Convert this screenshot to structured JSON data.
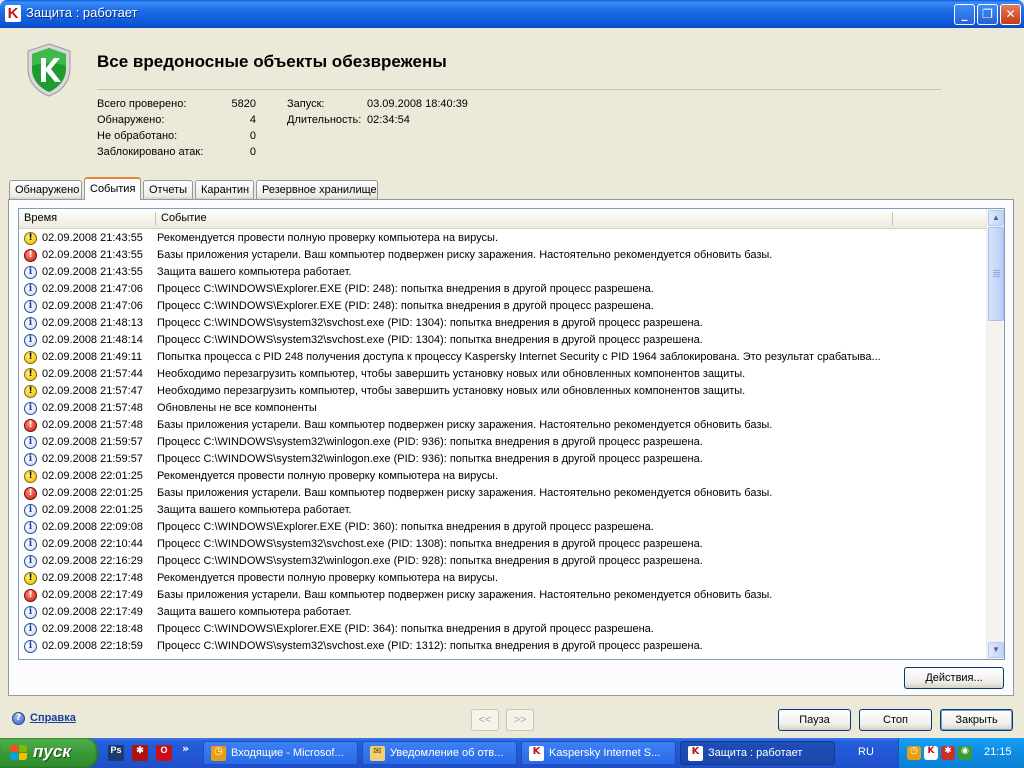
{
  "window": {
    "title": "Защита : работает",
    "app_icon": "kaspersky-k-icon"
  },
  "header": {
    "status_title": "Все вредоносные объекты обезврежены",
    "stats": [
      {
        "label": "Всего проверено:",
        "value": "5820"
      },
      {
        "label": "Обнаружено:",
        "value": "4"
      },
      {
        "label": "Не обработано:",
        "value": "0"
      },
      {
        "label": "Заблокировано атак:",
        "value": "0"
      }
    ],
    "run": {
      "label": "Запуск:",
      "value": "03.09.2008 18:40:39"
    },
    "duration": {
      "label": "Длительность:",
      "value": "02:34:54"
    }
  },
  "tabs": [
    {
      "label": "Обнаружено",
      "active": false
    },
    {
      "label": "События",
      "active": true
    },
    {
      "label": "Отчеты",
      "active": false
    },
    {
      "label": "Карантин",
      "active": false
    },
    {
      "label": "Резервное хранилище",
      "active": false
    }
  ],
  "events": {
    "columns": {
      "time": "Время",
      "event": "Событие"
    },
    "rows": [
      {
        "icon": "warning-icon",
        "time": "02.09.2008 21:43:55",
        "event": "Рекомендуется провести полную проверку компьютера на вирусы."
      },
      {
        "icon": "error-icon",
        "time": "02.09.2008 21:43:55",
        "event": "Базы приложения устарели. Ваш компьютер подвержен риску заражения. Настоятельно рекомендуется обновить базы."
      },
      {
        "icon": "info-icon",
        "time": "02.09.2008 21:43:55",
        "event": "Защита вашего компьютера работает."
      },
      {
        "icon": "info-icon",
        "time": "02.09.2008 21:47:06",
        "event": "Процесс C:\\WINDOWS\\Explorer.EXE (PID: 248): попытка внедрения в другой процесс разрешена."
      },
      {
        "icon": "info-icon",
        "time": "02.09.2008 21:47:06",
        "event": "Процесс C:\\WINDOWS\\Explorer.EXE (PID: 248): попытка внедрения в другой процесс разрешена."
      },
      {
        "icon": "info-icon",
        "time": "02.09.2008 21:48:13",
        "event": "Процесс C:\\WINDOWS\\system32\\svchost.exe (PID: 1304): попытка внедрения в другой процесс разрешена."
      },
      {
        "icon": "info-icon",
        "time": "02.09.2008 21:48:14",
        "event": "Процесс C:\\WINDOWS\\system32\\svchost.exe (PID: 1304): попытка внедрения в другой процесс разрешена."
      },
      {
        "icon": "warning-icon",
        "time": "02.09.2008 21:49:11",
        "event": "Попытка процесса  с PID 248 получения доступа к процессу Kaspersky Internet Security с PID 1964 заблокирована. Это результат срабатыва..."
      },
      {
        "icon": "warning-icon",
        "time": "02.09.2008 21:57:44",
        "event": "Необходимо перезагрузить компьютер, чтобы завершить установку новых или обновленных компонентов защиты."
      },
      {
        "icon": "warning-icon",
        "time": "02.09.2008 21:57:47",
        "event": "Необходимо перезагрузить компьютер, чтобы завершить установку новых или обновленных компонентов защиты."
      },
      {
        "icon": "info-icon",
        "time": "02.09.2008 21:57:48",
        "event": " Обновлены не все компоненты"
      },
      {
        "icon": "error-icon",
        "time": "02.09.2008 21:57:48",
        "event": "Базы приложения устарели. Ваш компьютер подвержен риску заражения. Настоятельно рекомендуется обновить базы."
      },
      {
        "icon": "info-icon",
        "time": "02.09.2008 21:59:57",
        "event": "Процесс C:\\WINDOWS\\system32\\winlogon.exe (PID: 936): попытка внедрения в другой процесс разрешена."
      },
      {
        "icon": "info-icon",
        "time": "02.09.2008 21:59:57",
        "event": "Процесс C:\\WINDOWS\\system32\\winlogon.exe (PID: 936): попытка внедрения в другой процесс разрешена."
      },
      {
        "icon": "warning-icon",
        "time": "02.09.2008 22:01:25",
        "event": "Рекомендуется провести полную проверку компьютера на вирусы."
      },
      {
        "icon": "error-icon",
        "time": "02.09.2008 22:01:25",
        "event": "Базы приложения устарели. Ваш компьютер подвержен риску заражения. Настоятельно рекомендуется обновить базы."
      },
      {
        "icon": "info-icon",
        "time": "02.09.2008 22:01:25",
        "event": "Защита вашего компьютера работает."
      },
      {
        "icon": "info-icon",
        "time": "02.09.2008 22:09:08",
        "event": "Процесс C:\\WINDOWS\\Explorer.EXE (PID: 360): попытка внедрения в другой процесс разрешена."
      },
      {
        "icon": "info-icon",
        "time": "02.09.2008 22:10:44",
        "event": "Процесс C:\\WINDOWS\\system32\\svchost.exe (PID: 1308): попытка внедрения в другой процесс разрешена."
      },
      {
        "icon": "info-icon",
        "time": "02.09.2008 22:16:29",
        "event": "Процесс C:\\WINDOWS\\system32\\winlogon.exe (PID: 928): попытка внедрения в другой процесс разрешена."
      },
      {
        "icon": "warning-icon",
        "time": "02.09.2008 22:17:48",
        "event": "Рекомендуется провести полную проверку компьютера на вирусы."
      },
      {
        "icon": "error-icon",
        "time": "02.09.2008 22:17:49",
        "event": "Базы приложения устарели. Ваш компьютер подвержен риску заражения. Настоятельно рекомендуется обновить базы."
      },
      {
        "icon": "info-icon",
        "time": "02.09.2008 22:17:49",
        "event": "Защита вашего компьютера работает."
      },
      {
        "icon": "info-icon",
        "time": "02.09.2008 22:18:48",
        "event": "Процесс C:\\WINDOWS\\Explorer.EXE (PID: 364): попытка внедрения в другой процесс разрешена."
      },
      {
        "icon": "info-icon",
        "time": "02.09.2008 22:18:59",
        "event": "Процесс C:\\WINDOWS\\system32\\svchost.exe (PID: 1312): попытка внедрения в другой процесс разрешена."
      }
    ]
  },
  "buttons": {
    "actions": "Действия...",
    "prev": "<<",
    "next": ">>",
    "pause": "Пауза",
    "stop": "Стоп",
    "close": "Закрыть"
  },
  "help": {
    "label": "Справка"
  },
  "taskbar": {
    "start": "пуск",
    "quick_launch": [
      {
        "icon": "photoshop-icon",
        "glyph": "Ps",
        "color": "#1B3A6E"
      },
      {
        "icon": "game-icon",
        "glyph": "✱",
        "color": "#B01010"
      },
      {
        "icon": "opera-icon",
        "glyph": "O",
        "color": "#C8101A"
      }
    ],
    "quick_more": "»",
    "tasks": [
      {
        "label": "Входящие - Microsof...",
        "icon": "outlook-icon",
        "active": false
      },
      {
        "label": "Уведомление об отв...",
        "icon": "mail-icon",
        "active": false
      },
      {
        "label": "Kaspersky Internet S...",
        "icon": "kaspersky-k-icon",
        "active": false
      },
      {
        "label": "Защита : работает",
        "icon": "kaspersky-k-icon",
        "active": true
      }
    ],
    "language": "RU",
    "clock": "21:15"
  }
}
